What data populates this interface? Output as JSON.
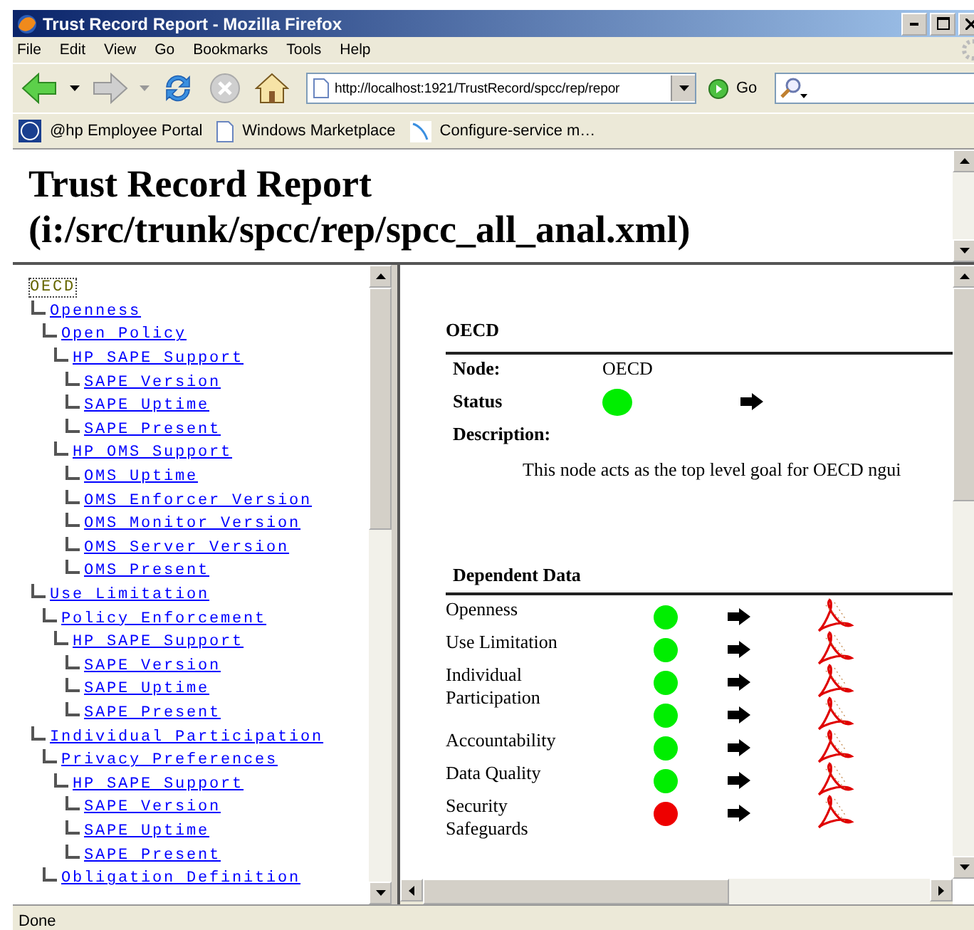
{
  "window": {
    "title": "Trust Record Report - Mozilla Firefox"
  },
  "menu": [
    "File",
    "Edit",
    "View",
    "Go",
    "Bookmarks",
    "Tools",
    "Help"
  ],
  "toolbar": {
    "url": "http://localhost:1921/TrustRecord/spcc/rep/repor",
    "go": "Go"
  },
  "bookmarks": [
    "@hp Employee Portal",
    "Windows Marketplace",
    "Configure-service m…"
  ],
  "header": {
    "title": "Trust Record Report",
    "path": "(i:/src/trunk/spcc/rep/spcc_all_anal.xml)"
  },
  "tree": {
    "label": "OECD",
    "selected": true,
    "children": [
      {
        "label": "Openness",
        "selected": false,
        "children": [
          {
            "label": "Open Policy",
            "selected": false,
            "children": [
              {
                "label": "HP SAPE Support",
                "selected": false,
                "children": [
                  {
                    "label": "SAPE Version",
                    "selected": false
                  },
                  {
                    "label": "SAPE Uptime",
                    "selected": false
                  },
                  {
                    "label": "SAPE Present",
                    "selected": false
                  }
                ]
              },
              {
                "label": "HP OMS Support",
                "selected": false,
                "children": [
                  {
                    "label": "OMS Uptime",
                    "selected": false
                  },
                  {
                    "label": "OMS Enforcer Version",
                    "selected": false
                  },
                  {
                    "label": "OMS Monitor Version",
                    "selected": false
                  },
                  {
                    "label": "OMS Server Version",
                    "selected": false
                  },
                  {
                    "label": "OMS Present",
                    "selected": false
                  }
                ]
              }
            ]
          }
        ]
      },
      {
        "label": "Use Limitation",
        "selected": false,
        "children": [
          {
            "label": "Policy Enforcement",
            "selected": false,
            "children": [
              {
                "label": "HP SAPE Support",
                "selected": false,
                "children": [
                  {
                    "label": "SAPE Version",
                    "selected": false
                  },
                  {
                    "label": "SAPE Uptime",
                    "selected": false
                  },
                  {
                    "label": "SAPE Present",
                    "selected": false
                  }
                ]
              }
            ]
          }
        ]
      },
      {
        "label": "Individual Participation",
        "selected": false,
        "children": [
          {
            "label": "Privacy Preferences",
            "selected": false,
            "children": [
              {
                "label": "HP SAPE Support",
                "selected": false,
                "children": [
                  {
                    "label": "SAPE Version",
                    "selected": false
                  },
                  {
                    "label": "SAPE Uptime",
                    "selected": false
                  },
                  {
                    "label": "SAPE Present",
                    "selected": false
                  }
                ]
              }
            ]
          },
          {
            "label": "Obligation Definition",
            "selected": false
          }
        ]
      }
    ]
  },
  "detail": {
    "heading": "OECD",
    "node_label": "Node:",
    "node": "OECD",
    "status_label": "Status",
    "status": {
      "color": "#00ee00"
    },
    "description_label": "Description:",
    "description": "This node acts as the top level goal for OECD ngui"
  },
  "dependent": {
    "heading": "Dependent Data",
    "rows": [
      {
        "name": "Openness",
        "color": "#00ee00"
      },
      {
        "name": "Use Limitation",
        "color": "#00ee00"
      },
      {
        "name": "Individual Participation",
        "color": "#00ee00"
      },
      {
        "color": "#00ee00"
      },
      {
        "name": "Accountability",
        "color": "#00ee00"
      },
      {
        "name": "Data Quality",
        "color": "#00ee00"
      },
      {
        "name": "Security Safeguards",
        "color": "#ee0000"
      }
    ]
  },
  "status_bar": "Done"
}
